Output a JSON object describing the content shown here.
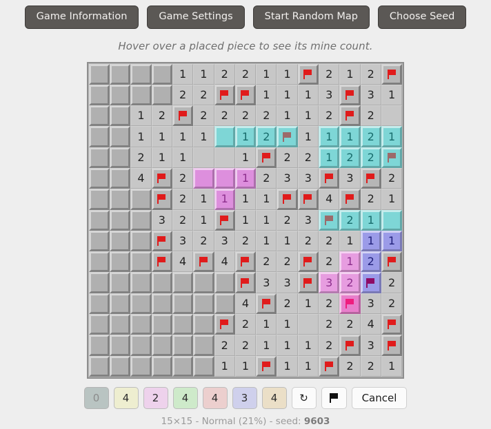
{
  "toolbar": {
    "buttons": [
      {
        "label": "Game Information",
        "name": "game-information-button"
      },
      {
        "label": "Game Settings",
        "name": "game-settings-button"
      },
      {
        "label": "Start Random Map",
        "name": "start-random-map-button"
      },
      {
        "label": "Choose Seed",
        "name": "choose-seed-button"
      }
    ]
  },
  "hint": "Hover over a placed piece to see its mine count.",
  "board": {
    "rows": 15,
    "cols": 15,
    "colors": {
      "hidden": "#b0b0b0",
      "open": "#c7c7c7",
      "flag_red": "#e01b1b",
      "cyan": "#7ed6d6",
      "cyan_flag": "#9c6a6a",
      "orchid": "#dd8fdd",
      "orchid_number": "#8d2f8d",
      "pink": "#e79de0",
      "pink_flag": "#b01070",
      "hotpink": "#e87ecb",
      "hotpink_flag": "#ef1d7e",
      "periwinkle": "#9b9be8",
      "periwinkle_number": "#20207a",
      "periwinkle_flag": "#8e0b66"
    },
    "cells": [
      [
        {
          "s": "h"
        },
        {
          "s": "h"
        },
        {
          "s": "h"
        },
        {
          "s": "h"
        },
        {
          "s": "o",
          "v": "1"
        },
        {
          "s": "o",
          "v": "1"
        },
        {
          "s": "o",
          "v": "2"
        },
        {
          "s": "o",
          "v": "2"
        },
        {
          "s": "o",
          "v": "1"
        },
        {
          "s": "o",
          "v": "1"
        },
        {
          "s": "f"
        },
        {
          "s": "o",
          "v": "2"
        },
        {
          "s": "o",
          "v": "1"
        },
        {
          "s": "o",
          "v": "2"
        },
        {
          "s": "f"
        }
      ],
      [
        {
          "s": "h"
        },
        {
          "s": "h"
        },
        {
          "s": "h"
        },
        {
          "s": "h"
        },
        {
          "s": "o",
          "v": "2"
        },
        {
          "s": "o",
          "v": "2"
        },
        {
          "s": "f"
        },
        {
          "s": "f"
        },
        {
          "s": "o",
          "v": "1"
        },
        {
          "s": "o",
          "v": "1"
        },
        {
          "s": "o",
          "v": "1"
        },
        {
          "s": "o",
          "v": "3"
        },
        {
          "s": "f"
        },
        {
          "s": "o",
          "v": "3"
        },
        {
          "s": "o",
          "v": "1"
        }
      ],
      [
        {
          "s": "h"
        },
        {
          "s": "h"
        },
        {
          "s": "o",
          "v": "1"
        },
        {
          "s": "o",
          "v": "2"
        },
        {
          "s": "f"
        },
        {
          "s": "o",
          "v": "2"
        },
        {
          "s": "o",
          "v": "2"
        },
        {
          "s": "o",
          "v": "2"
        },
        {
          "s": "o",
          "v": "2"
        },
        {
          "s": "o",
          "v": "1"
        },
        {
          "s": "o",
          "v": "1"
        },
        {
          "s": "o",
          "v": "2"
        },
        {
          "s": "f"
        },
        {
          "s": "o",
          "v": "2"
        },
        {
          "s": "o",
          "v": ""
        }
      ],
      [
        {
          "s": "h"
        },
        {
          "s": "h"
        },
        {
          "s": "o",
          "v": "1"
        },
        {
          "s": "o",
          "v": "1"
        },
        {
          "s": "o",
          "v": "1"
        },
        {
          "s": "o",
          "v": "1"
        },
        {
          "s": "p",
          "c": "cyan",
          "v": ""
        },
        {
          "s": "p",
          "c": "cyan",
          "v": "1"
        },
        {
          "s": "p",
          "c": "cyan",
          "v": "2"
        },
        {
          "s": "pf",
          "c": "cyan"
        },
        {
          "s": "o",
          "v": "1"
        },
        {
          "s": "p",
          "c": "cyan",
          "v": "1"
        },
        {
          "s": "p",
          "c": "cyan",
          "v": "1"
        },
        {
          "s": "p",
          "c": "cyan",
          "v": "2"
        },
        {
          "s": "p",
          "c": "cyan",
          "v": "1"
        }
      ],
      [
        {
          "s": "h"
        },
        {
          "s": "h"
        },
        {
          "s": "o",
          "v": "2"
        },
        {
          "s": "o",
          "v": "1"
        },
        {
          "s": "o",
          "v": "1"
        },
        {
          "s": "o",
          "v": ""
        },
        {
          "s": "o",
          "v": ""
        },
        {
          "s": "o",
          "v": "1"
        },
        {
          "s": "f"
        },
        {
          "s": "o",
          "v": "2"
        },
        {
          "s": "o",
          "v": "2"
        },
        {
          "s": "p",
          "c": "cyan",
          "v": "1"
        },
        {
          "s": "p",
          "c": "cyan",
          "v": "2"
        },
        {
          "s": "p",
          "c": "cyan",
          "v": "2"
        },
        {
          "s": "pf",
          "c": "cyan"
        }
      ],
      [
        {
          "s": "h"
        },
        {
          "s": "h"
        },
        {
          "s": "o",
          "v": "4"
        },
        {
          "s": "f"
        },
        {
          "s": "o",
          "v": "2"
        },
        {
          "s": "p",
          "c": "orchid",
          "v": ""
        },
        {
          "s": "p",
          "c": "orchid",
          "v": ""
        },
        {
          "s": "p",
          "c": "orchid",
          "v": "1"
        },
        {
          "s": "o",
          "v": "2"
        },
        {
          "s": "o",
          "v": "3"
        },
        {
          "s": "o",
          "v": "3"
        },
        {
          "s": "f"
        },
        {
          "s": "o",
          "v": "3"
        },
        {
          "s": "f"
        },
        {
          "s": "o",
          "v": "2"
        }
      ],
      [
        {
          "s": "h"
        },
        {
          "s": "h"
        },
        {
          "s": "h"
        },
        {
          "s": "f"
        },
        {
          "s": "o",
          "v": "2"
        },
        {
          "s": "o",
          "v": "1"
        },
        {
          "s": "p",
          "c": "orchid",
          "v": "1"
        },
        {
          "s": "o",
          "v": "1"
        },
        {
          "s": "o",
          "v": "1"
        },
        {
          "s": "f"
        },
        {
          "s": "f"
        },
        {
          "s": "o",
          "v": "4"
        },
        {
          "s": "f"
        },
        {
          "s": "o",
          "v": "2"
        },
        {
          "s": "o",
          "v": "1"
        }
      ],
      [
        {
          "s": "h"
        },
        {
          "s": "h"
        },
        {
          "s": "h"
        },
        {
          "s": "o",
          "v": "3"
        },
        {
          "s": "o",
          "v": "2"
        },
        {
          "s": "o",
          "v": "1"
        },
        {
          "s": "f"
        },
        {
          "s": "o",
          "v": "1"
        },
        {
          "s": "o",
          "v": "1"
        },
        {
          "s": "o",
          "v": "2"
        },
        {
          "s": "o",
          "v": "3"
        },
        {
          "s": "pf",
          "c": "cyan"
        },
        {
          "s": "p",
          "c": "cyan",
          "v": "2"
        },
        {
          "s": "p",
          "c": "cyan",
          "v": "1"
        },
        {
          "s": "p",
          "c": "cyan",
          "v": ""
        }
      ],
      [
        {
          "s": "h"
        },
        {
          "s": "h"
        },
        {
          "s": "h"
        },
        {
          "s": "f"
        },
        {
          "s": "o",
          "v": "3"
        },
        {
          "s": "o",
          "v": "2"
        },
        {
          "s": "o",
          "v": "3"
        },
        {
          "s": "o",
          "v": "2"
        },
        {
          "s": "o",
          "v": "1"
        },
        {
          "s": "o",
          "v": "1"
        },
        {
          "s": "o",
          "v": "2"
        },
        {
          "s": "o",
          "v": "2"
        },
        {
          "s": "o",
          "v": "1"
        },
        {
          "s": "p",
          "c": "periwinkle",
          "v": "1"
        },
        {
          "s": "p",
          "c": "periwinkle",
          "v": "1"
        }
      ],
      [
        {
          "s": "h"
        },
        {
          "s": "h"
        },
        {
          "s": "h"
        },
        {
          "s": "f"
        },
        {
          "s": "o",
          "v": "4"
        },
        {
          "s": "f"
        },
        {
          "s": "o",
          "v": "4"
        },
        {
          "s": "f"
        },
        {
          "s": "o",
          "v": "2"
        },
        {
          "s": "o",
          "v": "2"
        },
        {
          "s": "f"
        },
        {
          "s": "o",
          "v": "2"
        },
        {
          "s": "p",
          "c": "pink",
          "v": "1"
        },
        {
          "s": "p",
          "c": "periwinkle",
          "v": "2"
        },
        {
          "s": "f"
        }
      ],
      [
        {
          "s": "h"
        },
        {
          "s": "h"
        },
        {
          "s": "h"
        },
        {
          "s": "h"
        },
        {
          "s": "h"
        },
        {
          "s": "h"
        },
        {
          "s": "h"
        },
        {
          "s": "f"
        },
        {
          "s": "o",
          "v": "3"
        },
        {
          "s": "o",
          "v": "3"
        },
        {
          "s": "f"
        },
        {
          "s": "p",
          "c": "pink",
          "v": "3"
        },
        {
          "s": "p",
          "c": "pink",
          "v": "2"
        },
        {
          "s": "pf",
          "c": "periwinkle"
        },
        {
          "s": "o",
          "v": "2"
        }
      ],
      [
        {
          "s": "h"
        },
        {
          "s": "h"
        },
        {
          "s": "h"
        },
        {
          "s": "h"
        },
        {
          "s": "h"
        },
        {
          "s": "h"
        },
        {
          "s": "h"
        },
        {
          "s": "o",
          "v": "4"
        },
        {
          "s": "f"
        },
        {
          "s": "o",
          "v": "2"
        },
        {
          "s": "o",
          "v": "1"
        },
        {
          "s": "o",
          "v": "2"
        },
        {
          "s": "pf",
          "c": "hotpink"
        },
        {
          "s": "o",
          "v": "3"
        },
        {
          "s": "o",
          "v": "2"
        }
      ],
      [
        {
          "s": "h"
        },
        {
          "s": "h"
        },
        {
          "s": "h"
        },
        {
          "s": "h"
        },
        {
          "s": "h"
        },
        {
          "s": "h"
        },
        {
          "s": "f"
        },
        {
          "s": "o",
          "v": "2"
        },
        {
          "s": "o",
          "v": "1"
        },
        {
          "s": "o",
          "v": "1"
        },
        {
          "s": "o",
          "v": ""
        },
        {
          "s": "o",
          "v": "2"
        },
        {
          "s": "o",
          "v": "2"
        },
        {
          "s": "o",
          "v": "4"
        },
        {
          "s": "f"
        }
      ],
      [
        {
          "s": "h"
        },
        {
          "s": "h"
        },
        {
          "s": "h"
        },
        {
          "s": "h"
        },
        {
          "s": "h"
        },
        {
          "s": "h"
        },
        {
          "s": "o",
          "v": "2"
        },
        {
          "s": "o",
          "v": "2"
        },
        {
          "s": "o",
          "v": "1"
        },
        {
          "s": "o",
          "v": "1"
        },
        {
          "s": "o",
          "v": "1"
        },
        {
          "s": "o",
          "v": "2"
        },
        {
          "s": "f"
        },
        {
          "s": "o",
          "v": "3"
        },
        {
          "s": "f"
        }
      ],
      [
        {
          "s": "h"
        },
        {
          "s": "h"
        },
        {
          "s": "h"
        },
        {
          "s": "h"
        },
        {
          "s": "h"
        },
        {
          "s": "h"
        },
        {
          "s": "o",
          "v": "1"
        },
        {
          "s": "o",
          "v": "1"
        },
        {
          "s": "f"
        },
        {
          "s": "o",
          "v": "1"
        },
        {
          "s": "o",
          "v": "1"
        },
        {
          "s": "f"
        },
        {
          "s": "o",
          "v": "2"
        },
        {
          "s": "o",
          "v": "2"
        },
        {
          "s": "o",
          "v": "1"
        }
      ]
    ]
  },
  "palette": {
    "pieces": [
      {
        "label": "0",
        "bg": "#b9c4c2",
        "used": true,
        "name": "piece-button-0"
      },
      {
        "label": "4",
        "bg": "#eeeed0",
        "used": false,
        "name": "piece-button-1"
      },
      {
        "label": "2",
        "bg": "#eed2ec",
        "used": false,
        "name": "piece-button-2"
      },
      {
        "label": "4",
        "bg": "#ceeaca",
        "used": false,
        "name": "piece-button-3"
      },
      {
        "label": "4",
        "bg": "#eccfce",
        "used": false,
        "name": "piece-button-4"
      },
      {
        "label": "3",
        "bg": "#cfd0ec",
        "used": false,
        "name": "piece-button-5"
      },
      {
        "label": "4",
        "bg": "#ebdfc7",
        "used": false,
        "name": "piece-button-6"
      }
    ],
    "undo_icon": "undo-arrow-icon",
    "undo_glyph": "↻",
    "flag_icon": "flag-icon",
    "cancel_label": "Cancel"
  },
  "footer": {
    "prefix": "15×15 - Normal (21%) - seed: ",
    "seed": "9603"
  }
}
